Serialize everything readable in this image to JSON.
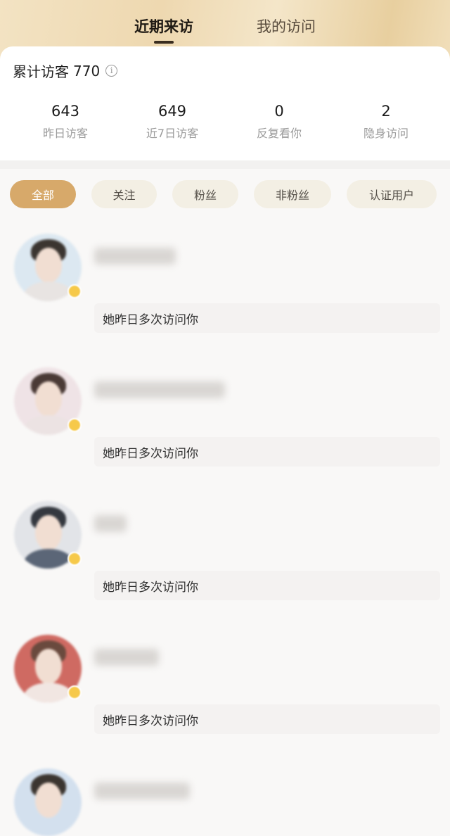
{
  "tabs": [
    {
      "label": "近期来访",
      "active": true
    },
    {
      "label": "我的访问",
      "active": false
    }
  ],
  "summary": {
    "total_label": "累计访客",
    "total_value": "770"
  },
  "stats": [
    {
      "value": "643",
      "label": "昨日访客"
    },
    {
      "value": "649",
      "label": "近7日访客"
    },
    {
      "value": "0",
      "label": "反复看你"
    },
    {
      "value": "2",
      "label": "隐身访问"
    }
  ],
  "filters": [
    {
      "label": "全部",
      "active": true
    },
    {
      "label": "关注",
      "active": false
    },
    {
      "label": "粉丝",
      "active": false
    },
    {
      "label": "非粉丝",
      "active": false
    },
    {
      "label": "认证用户",
      "active": false
    }
  ],
  "visitors": [
    {
      "message": "她昨日多次访问你"
    },
    {
      "message": "她昨日多次访问你"
    },
    {
      "message": "她昨日多次访问你"
    },
    {
      "message": "她昨日多次访问你"
    }
  ],
  "colors": {
    "accent": "#d7a96a",
    "header_gold": "#eed8b0",
    "badge": "#f6c94a"
  },
  "icons": {
    "info": "info-circle-icon",
    "vip_badge": "vip-badge-icon"
  }
}
